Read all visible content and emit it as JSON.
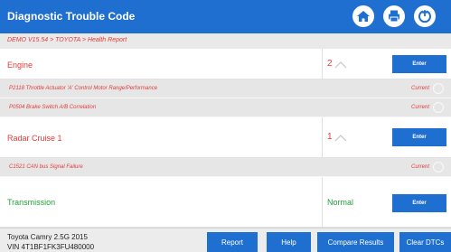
{
  "header": {
    "title": "Diagnostic Trouble Code"
  },
  "breadcrumb": "DEMO V15.54 > TOYOTA > Health Report",
  "systems": [
    {
      "name": "Engine",
      "count": "2",
      "enter_label": "Enter",
      "dtcs": [
        {
          "description": "P2118 Throttle Actuator 'A' Control Motor Range/Performance",
          "status": "Current"
        },
        {
          "description": "P0504 Brake Switch A/B Correlation",
          "status": "Current"
        }
      ]
    },
    {
      "name": "Radar Cruise 1",
      "count": "1",
      "enter_label": "Enter",
      "dtcs": [
        {
          "description": "C1521 CAN bus Signal Failure",
          "status": "Current"
        }
      ]
    },
    {
      "name": "Transmission",
      "count": "Normal",
      "enter_label": "Enter",
      "dtcs": []
    }
  ],
  "vehicle": {
    "model": "Toyota Camry 2.5G 2015",
    "vin": "VIN 4T1BF1FK3FU480000"
  },
  "actions": {
    "report": "Report",
    "help": "Help",
    "compare": "Compare Results",
    "clear": "Clear DTCs"
  },
  "colors": {
    "primary": "#1f6fd0",
    "fault_text": "#e23b3b",
    "normal_text": "#23a23a"
  }
}
